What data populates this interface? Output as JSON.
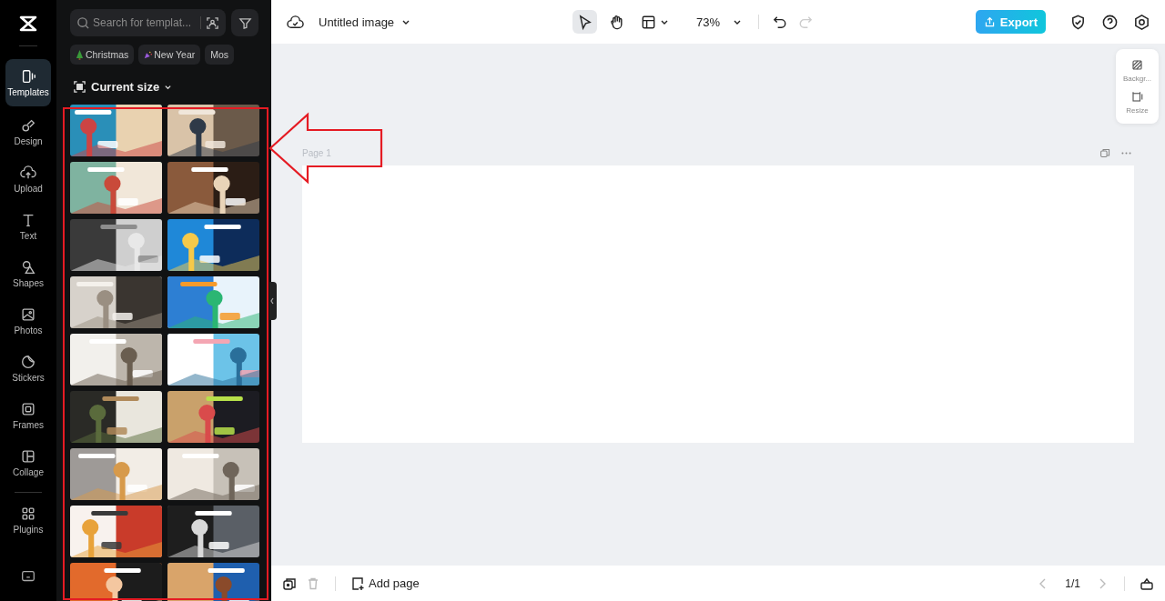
{
  "rail": {
    "items": [
      {
        "kind": "templates",
        "label": "Templates",
        "selected": true
      },
      {
        "kind": "design",
        "label": "Design",
        "selected": false
      },
      {
        "kind": "upload",
        "label": "Upload",
        "selected": false
      },
      {
        "kind": "text",
        "label": "Text",
        "selected": false
      },
      {
        "kind": "shapes",
        "label": "Shapes",
        "selected": false
      },
      {
        "kind": "photos",
        "label": "Photos",
        "selected": false
      },
      {
        "kind": "stickers",
        "label": "Stickers",
        "selected": false
      },
      {
        "kind": "frames",
        "label": "Frames",
        "selected": false
      },
      {
        "kind": "collage",
        "label": "Collage",
        "selected": false
      },
      {
        "kind": "plugins",
        "label": "Plugins",
        "selected": false
      }
    ]
  },
  "panel": {
    "search": {
      "placeholder": "Search for templat..."
    },
    "chips": [
      {
        "kind": "tree",
        "label": "Christmas"
      },
      {
        "kind": "party",
        "label": "New Year"
      },
      {
        "kind": "plain",
        "label": "Mos"
      }
    ],
    "size_filter": "Current size"
  },
  "toolbar": {
    "title": "Untitled image",
    "zoom": "73%",
    "export": "Export"
  },
  "side_tools": [
    {
      "kind": "background",
      "label": "Backgr..."
    },
    {
      "kind": "resize",
      "label": "Resize"
    }
  ],
  "canvas": {
    "page_label": "Page 1"
  },
  "bottom": {
    "add_page": "Add page",
    "page_count": "1/1"
  }
}
